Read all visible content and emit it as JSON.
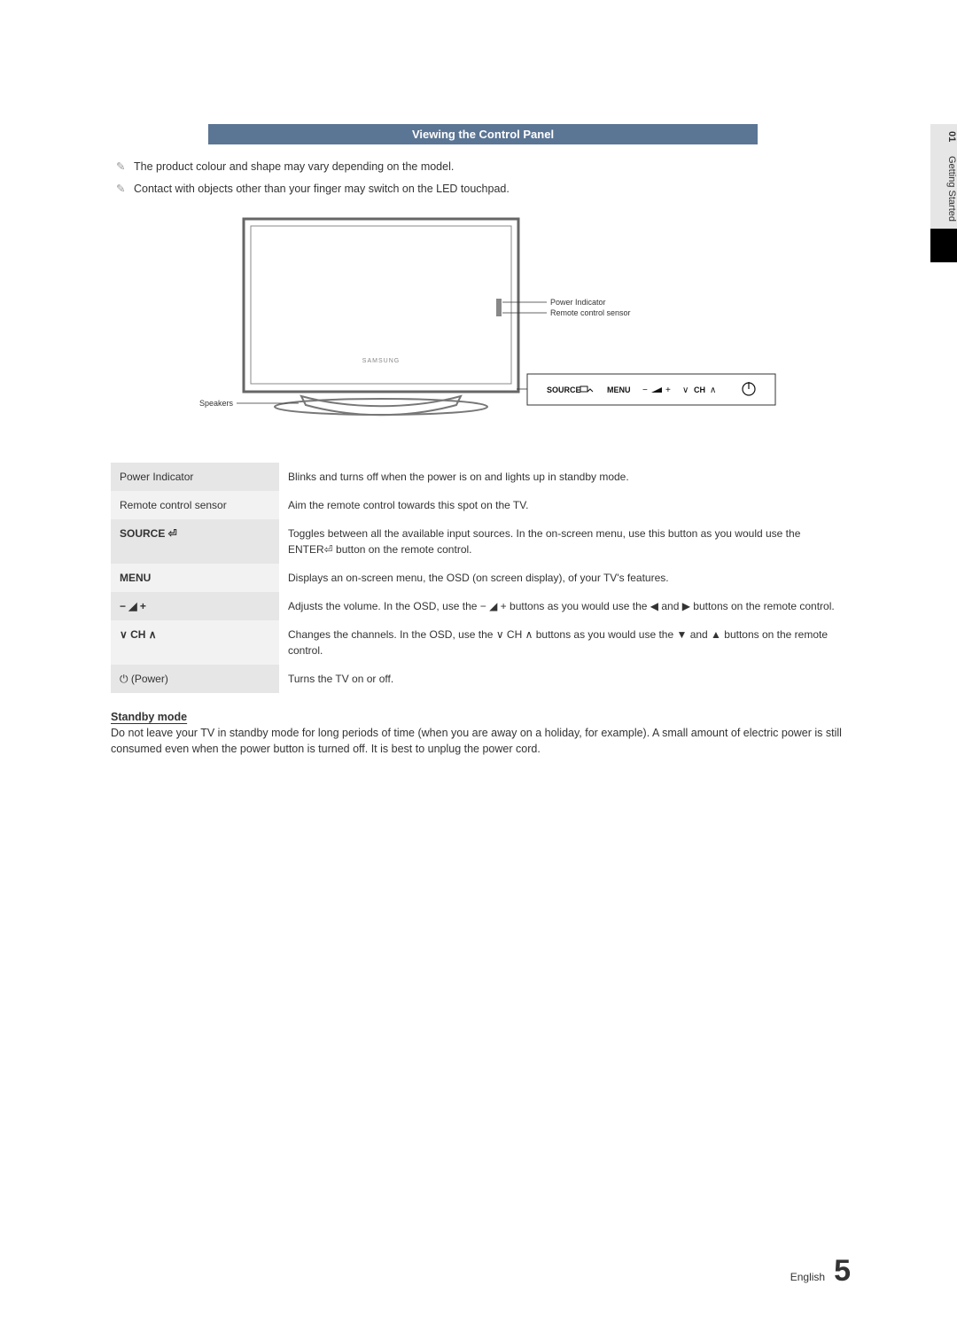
{
  "sidebar": {
    "chapter_no": "01",
    "chapter_title": "Getting Started"
  },
  "section_header": "Viewing the Control Panel",
  "notes": [
    "The product colour and shape may vary depending on the model.",
    "Contact with objects other than your finger may switch on the LED touchpad."
  ],
  "diagram": {
    "label_power_indicator": "Power Indicator",
    "label_remote_sensor": "Remote control sensor",
    "label_speakers": "Speakers",
    "panel": {
      "source": "SOURCE",
      "menu": "MENU",
      "ch": "CH"
    },
    "brand": "SAMSUNG"
  },
  "rows": [
    {
      "label": "Power Indicator",
      "strong": false,
      "desc": "Blinks and turns off when the power is on and lights up in standby mode."
    },
    {
      "label": "Remote control sensor",
      "strong": false,
      "desc": "Aim the remote control towards this spot on the TV."
    },
    {
      "label": "SOURCE ⏎",
      "strong": true,
      "desc": "Toggles between all the available input sources. In the on-screen menu, use this button as you would use the ENTER⏎ button on the remote control."
    },
    {
      "label": "MENU",
      "strong": true,
      "desc": "Displays an on-screen menu, the OSD (on screen display), of your TV's features."
    },
    {
      "label": "− ◢ +",
      "strong": true,
      "desc": "Adjusts the volume. In the OSD, use the − ◢ + buttons as you would use the ◀ and ▶ buttons on the remote control."
    },
    {
      "label": "∨ CH ∧",
      "strong": true,
      "desc": "Changes the channels. In the OSD, use the ∨ CH ∧ buttons as you would use the ▼ and ▲ buttons on the remote control."
    },
    {
      "label": "⏻ (Power)",
      "strong": false,
      "desc": "Turns the TV on or off."
    }
  ],
  "standby": {
    "title": "Standby mode",
    "body": "Do not leave your TV in standby mode for long periods of time (when you are away on a holiday, for example). A small amount of electric power is still consumed even when the power button is turned off. It is best to unplug the power cord."
  },
  "footer": {
    "language": "English",
    "page_number": "5"
  }
}
